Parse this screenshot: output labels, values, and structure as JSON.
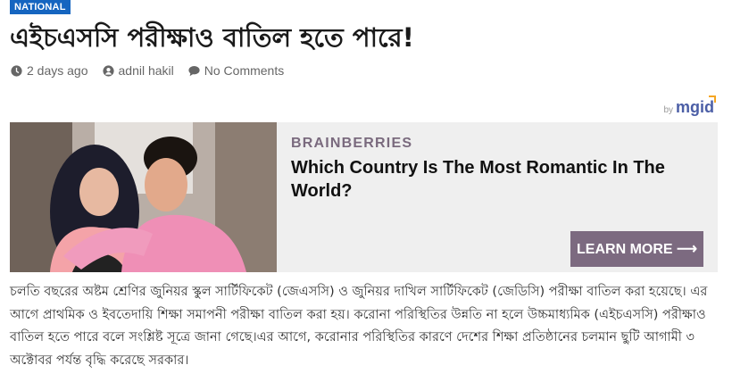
{
  "category": "NATIONAL",
  "headline": "এইচএসসি পরীক্ষাও বাতিল হতে পারে!",
  "meta": {
    "time": "2 days ago",
    "author": "adnil hakil",
    "comments": "No Comments"
  },
  "sponsor": {
    "by": "by",
    "logo": "mgid"
  },
  "ad": {
    "source": "BRAINBERRIES",
    "title": "Which Country Is The Most Romantic In The World?",
    "cta": "LEARN MORE ⟶"
  },
  "article_text": "চলতি বছরের অষ্টম শ্রেণির জুনিয়র স্কুল সার্টিফিকেট (জেএসসি) ও জুনিয়র দাখিল সার্টিফিকেট (জেডিসি) পরীক্ষা বাতিল করা হয়েছে। এর আগে প্রাথমিক ও ইবতেদায়ি শিক্ষা সমাপনী পরীক্ষা বাতিল করা হয়। করোনা পরিস্থিতির উন্নতি না হলে উচ্চমাধ্যমিক (এইচএসসি) পরীক্ষাও বাতিল হতে পারে বলে সংশ্লিষ্ট সূত্রে জানা গেছে।এর আগে, করোনার পরিস্থিতির কারণে দেশের শিক্ষা প্রতিষ্ঠানের চলমান ছুটি আগামী ৩ অক্টোবর পর্যন্ত বৃদ্ধি করেছে সরকার।"
}
